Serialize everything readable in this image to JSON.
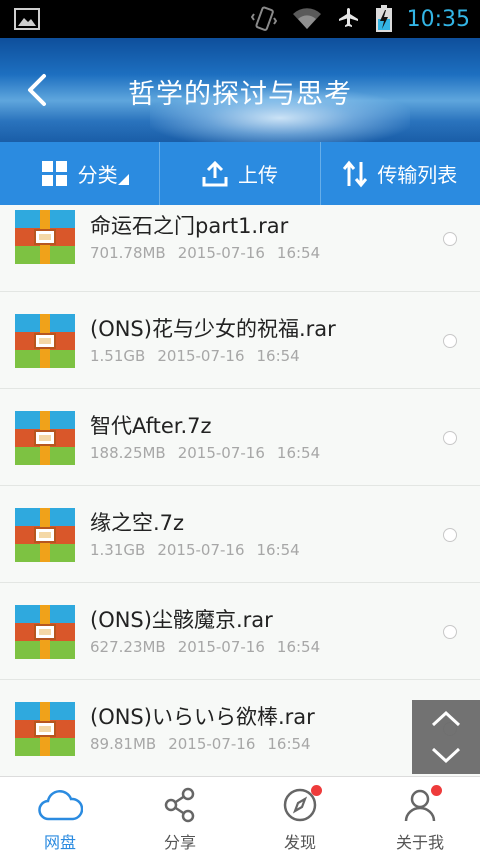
{
  "status_bar": {
    "time": "10:35"
  },
  "header": {
    "title": "哲学的探讨与思考"
  },
  "toolbar": {
    "category_label": "分类",
    "upload_label": "上传",
    "transfer_label": "传输列表"
  },
  "files": [
    {
      "name": "命运石之门part1.rar",
      "size": "701.78MB",
      "date": "2015-07-16",
      "time": "16:54"
    },
    {
      "name": "(ONS)花与少女的祝福.rar",
      "size": "1.51GB",
      "date": "2015-07-16",
      "time": "16:54"
    },
    {
      "name": "智代After.7z",
      "size": "188.25MB",
      "date": "2015-07-16",
      "time": "16:54"
    },
    {
      "name": "缘之空.7z",
      "size": "1.31GB",
      "date": "2015-07-16",
      "time": "16:54"
    },
    {
      "name": "(ONS)尘骸魔京.rar",
      "size": "627.23MB",
      "date": "2015-07-16",
      "time": "16:54"
    },
    {
      "name": "(ONS)いらいら欲棒.rar",
      "size": "89.81MB",
      "date": "2015-07-16",
      "time": "16:54"
    }
  ],
  "bottom_nav": {
    "items": [
      {
        "label": "网盘",
        "icon": "cloud-icon",
        "active": true,
        "badge": false
      },
      {
        "label": "分享",
        "icon": "share-icon",
        "active": false,
        "badge": false
      },
      {
        "label": "发现",
        "icon": "compass-icon",
        "active": false,
        "badge": true
      },
      {
        "label": "关于我",
        "icon": "user-icon",
        "active": false,
        "badge": true
      }
    ]
  },
  "colors": {
    "accent": "#2b8be0",
    "badge": "#ee3b3b",
    "statusbar_text": "#33b5e5"
  }
}
